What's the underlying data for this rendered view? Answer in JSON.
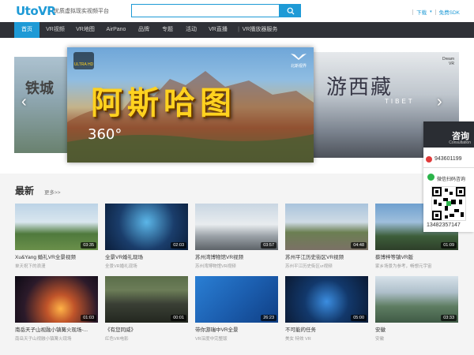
{
  "header": {
    "logo": "UtoVR",
    "slogan": "优质虚拟现实视频平台",
    "search_placeholder": "",
    "links": [
      "下载",
      "免费SDK"
    ]
  },
  "nav": {
    "items": [
      "首页",
      "VR视频",
      "VR地图",
      "AirPano",
      "品牌",
      "专题",
      "活动",
      "VR直播",
      "VR播放器服务"
    ],
    "active_index": 0
  },
  "banner": {
    "left_text": "铁城",
    "main_title": "阿斯哈图",
    "main_360": "360°",
    "main_badge": "ULTRA HD",
    "main_mark": "北斯视界",
    "right_text": "游西藏",
    "right_sub": "TIBET",
    "right_corner": "Dream\nVR"
  },
  "section": {
    "title": "最新",
    "more": "更多>>"
  },
  "cards": [
    {
      "title": "Xu&Yang 婚礼VR全景视频",
      "sub": "单天祝下的浪漫",
      "duration": "03:35"
    },
    {
      "title": "全景VR婚礼现场",
      "sub": "全景VR婚礼现场",
      "duration": "02:03"
    },
    {
      "title": "苏州湾博物馆VR视频",
      "sub": "苏州湾博物馆VR视频",
      "duration": "03:57"
    },
    {
      "title": "苏州平江历史街区VR视频",
      "sub": "苏州平江历史街区vr视频",
      "duration": "04:48"
    },
    {
      "title": "蔡博梓等镇VR版",
      "sub": "家乡场景为参考，畅想元宇宙",
      "duration": "01:09"
    },
    {
      "title": "南岳天子山视融小镇篝火现场-...",
      "sub": "南岳天子山视融小镇篝火现场",
      "duration": "01:03"
    },
    {
      "title": "《有您同威》",
      "sub": "红色VR电影",
      "duration": "00:01"
    },
    {
      "title": "带你游瑞中VR全景",
      "sub": "VR深度中完整版",
      "duration": "26:23"
    },
    {
      "title": "不可能的任务",
      "sub": "美女 特效 VR",
      "duration": "05:00"
    },
    {
      "title": "安徽",
      "sub": "安徽",
      "duration": "03:33"
    }
  ],
  "consult": {
    "title": "咨询",
    "en": "Consultation",
    "phone": "943601199",
    "wechat": "微信扫码咨询",
    "number": "13482357147"
  },
  "colors": {
    "brand": "#1e9ad6",
    "nav_bg": "#2f3137",
    "title_yellow": "#ffd21f"
  }
}
